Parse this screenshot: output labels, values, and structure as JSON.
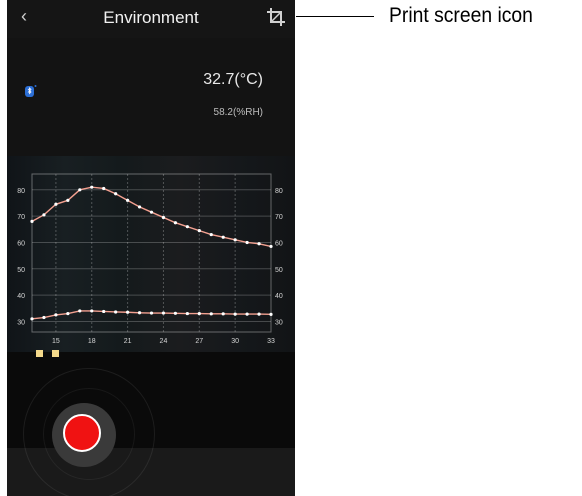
{
  "header": {
    "back_glyph": "‹",
    "title": "Environment",
    "crop_icon": "crop-icon"
  },
  "readout": {
    "bluetooth_icon": "bluetooth-icon",
    "temperature": "32.7(°C)",
    "humidity": "58.2(%RH)"
  },
  "chart_data": {
    "type": "line",
    "x": [
      13,
      14,
      15,
      16,
      17,
      18,
      19,
      20,
      21,
      22,
      23,
      24,
      25,
      26,
      27,
      28,
      29,
      30,
      31,
      32,
      33
    ],
    "xticks": [
      "15",
      "18",
      "21",
      "24",
      "27",
      "30",
      "33"
    ],
    "xtick_values": [
      15,
      18,
      21,
      24,
      27,
      30,
      33
    ],
    "yticks_left": [
      "80",
      "70",
      "60",
      "50",
      "40",
      "30"
    ],
    "yticks_right": [
      "80",
      "70",
      "60",
      "50",
      "40",
      "30"
    ],
    "ytick_values": [
      80,
      70,
      60,
      50,
      40,
      30
    ],
    "ylim": [
      26,
      86
    ],
    "xlim": [
      13,
      33
    ],
    "grid": true,
    "series": [
      {
        "values": [
          68,
          70.5,
          74.5,
          76,
          80,
          81,
          80.5,
          78.5,
          76,
          73.5,
          71.5,
          69.5,
          67.5,
          66,
          64.5,
          63,
          62,
          61,
          60,
          59.5,
          58.5
        ],
        "color": "#f3a090"
      },
      {
        "values": [
          31,
          31.5,
          32.5,
          33,
          34,
          34,
          33.8,
          33.6,
          33.5,
          33.3,
          33.2,
          33.2,
          33.1,
          33,
          33,
          32.9,
          32.9,
          32.8,
          32.8,
          32.8,
          32.7
        ],
        "color": "#f3a090"
      }
    ]
  },
  "legend": {
    "colors": [
      "#f4d98b",
      "#f4d98b"
    ]
  },
  "record": {
    "button_icon": "record-button"
  },
  "callout": {
    "label": "Print screen icon"
  }
}
